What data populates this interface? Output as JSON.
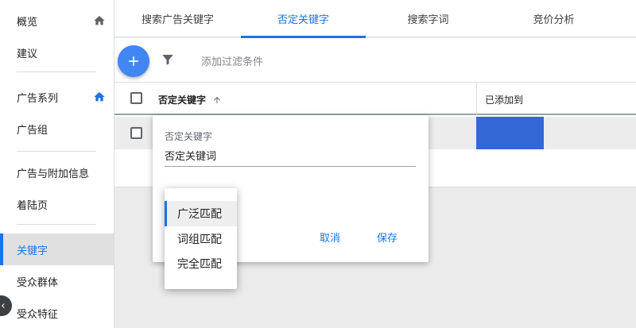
{
  "sidebar": {
    "items": [
      {
        "label": "概览"
      },
      {
        "label": "建议"
      },
      {
        "label": "广告系列"
      },
      {
        "label": "广告组"
      },
      {
        "label": "广告与附加信息"
      },
      {
        "label": "着陆页"
      },
      {
        "label": "关键字"
      },
      {
        "label": "受众群体"
      },
      {
        "label": "受众特征"
      }
    ],
    "active_index": 6,
    "accent_color": "#1a73e8"
  },
  "tabs": [
    {
      "label": "搜索广告关键字"
    },
    {
      "label": "否定关键字"
    },
    {
      "label": "搜索字词"
    },
    {
      "label": "竞价分析"
    }
  ],
  "active_tab_index": 1,
  "toolbar": {
    "filter_placeholder": "添加过滤条件",
    "fab_color": "#4285f4"
  },
  "table": {
    "columns": [
      {
        "label": "否定关键字"
      },
      {
        "label": "已添加到"
      }
    ]
  },
  "edit_popup": {
    "field_label": "否定关键字",
    "field_value": "否定关键词",
    "cancel_label": "取消",
    "save_label": "保存"
  },
  "match_dropdown": {
    "options": [
      {
        "label": "广泛匹配"
      },
      {
        "label": "词组匹配"
      },
      {
        "label": "完全匹配"
      }
    ],
    "selected_index": 0
  }
}
